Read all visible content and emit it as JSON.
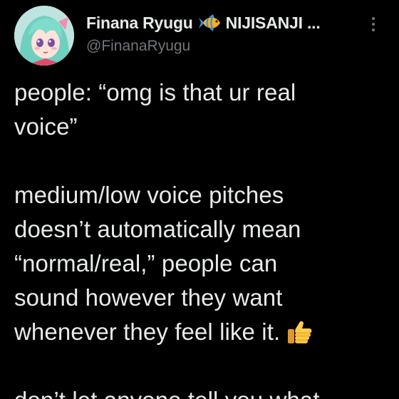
{
  "tweet": {
    "author": {
      "display_name": "Finana Ryugu",
      "name_emoji": "tropical-fish-icon",
      "affiliation": "NIJISANJI ...",
      "handle": "@FinanaRyugu",
      "avatar": "avatar-image"
    },
    "menu_icon": "more-vertical-icon",
    "text_lines": [
      "people: “omg is that ur real",
      "voice”",
      "",
      "medium/low voice pitches",
      "doesn’t automatically mean",
      "“normal/real,” people can",
      "sound however they want",
      "whenever they feel like it.",
      "",
      "don’t let anyone tell you what"
    ],
    "thumb_emoji": "thumbs-up-icon"
  },
  "colors": {
    "background": "#000000",
    "text": "#e7e9ea",
    "secondary_text": "#71767b"
  }
}
